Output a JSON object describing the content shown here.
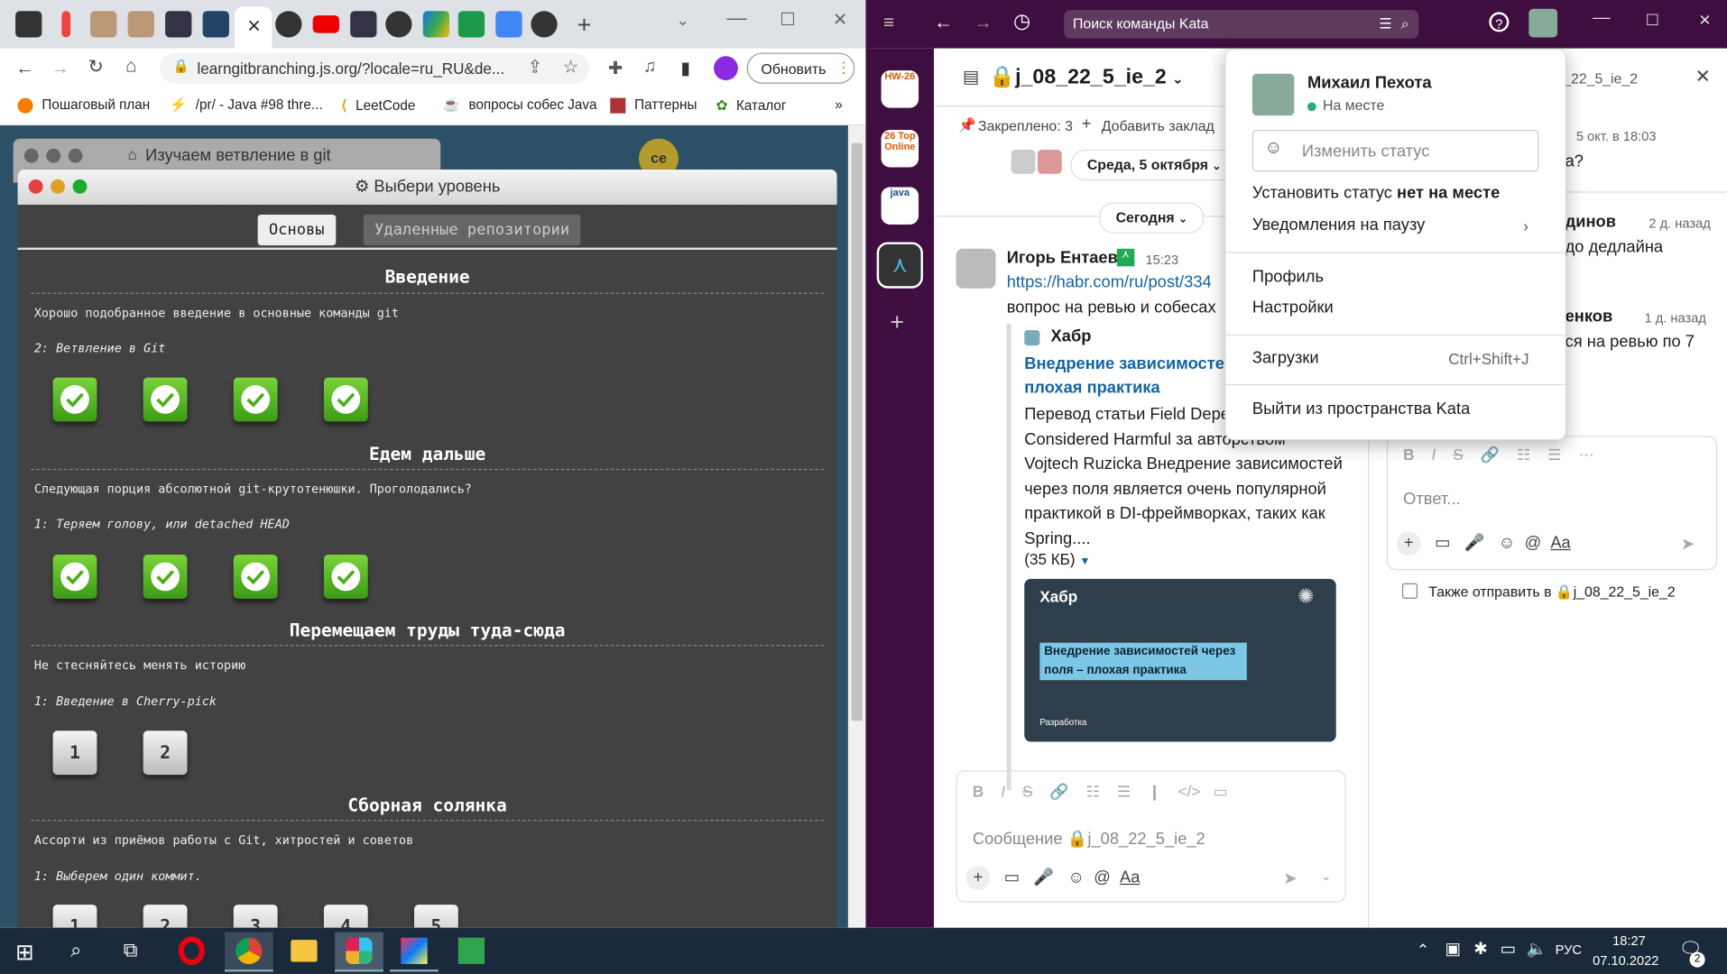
{
  "browser": {
    "url": "learngitbranching.js.org/?locale=ru_RU&de...",
    "update_button": "Обновить",
    "bookmarks": [
      "Пошаговый план",
      "/pr/ - Java #98 thre...",
      "LeetCode",
      "вопросы собес Java",
      "Паттерны",
      "Каталог"
    ]
  },
  "gitapp": {
    "bg_window_title": "Изучаем ветвление в git",
    "avatar_initials": "ce",
    "window_title": "Выбери уровень",
    "tabs": [
      "Основы",
      "Удаленные репозитории"
    ],
    "sections": [
      {
        "title": "Введение",
        "desc": "Хорошо подобранное введение в основные команды git",
        "sub": "2: Ветвление в Git",
        "levels": [
          "done",
          "done",
          "done",
          "done"
        ]
      },
      {
        "title": "Едем дальше",
        "desc": "Следующая порция абсолютной git-крутотенюшки. Проголодались?",
        "sub": "1: Теряем голову, или detached HEAD",
        "levels": [
          "done",
          "done",
          "done",
          "done"
        ]
      },
      {
        "title": "Перемещаем труды туда-сюда",
        "desc": "Не стесняйтесь менять историю",
        "sub": "1: Введение в Cherry-pick",
        "levels": [
          "1",
          "2"
        ]
      },
      {
        "title": "Сборная солянка",
        "desc": "Ассорти из приёмов работы с Git, хитростей и советов",
        "sub": "1: Выберем один коммит.",
        "levels": [
          "1",
          "2",
          "3",
          "4",
          "5"
        ]
      }
    ]
  },
  "slack": {
    "search_placeholder": "Поиск команды Kata",
    "workspaces": [
      "HW-26",
      "26 Top Online",
      "java"
    ],
    "channel_name": "j_08_22_5_ie_2",
    "pinned": "Закреплено: 3",
    "add_bookmark": "Добавить заклад",
    "date_chip": "Среда, 5 октября",
    "today_chip": "Сегодня",
    "message": {
      "author": "Игорь Ентаев",
      "time": "15:23",
      "link": "https://habr.com/ru/post/334",
      "text": "вопрос на ревью и собесах",
      "preview_site": "Хабр",
      "preview_title": "Внедрение зависимостей плохая практика",
      "preview_body": "Перевод статьи Field Depe Injection Considered Harmful за авторством Vojtech Ruzicka Внедрение зависимостей через поля является очень популярной практикой в DI-фреймворках, таких как Spring....",
      "preview_size": "(35 КБ)",
      "card_site": "Хабр",
      "card_title": "Внедрение зависимостей через поля – плохая практика",
      "card_tag": "Разработка"
    },
    "composer_placeholder": "Сообщение 🔒j_08_22_5_ie_2",
    "thread": {
      "header": "_22_5_ie_2",
      "m1_time": "5 окт. в 18:03",
      "m1_text": "а?",
      "m2_author": "динов",
      "m2_time": "2 д. назад",
      "m2_text": "до дедлайна",
      "m3_author": "енков",
      "m3_time": "1 д. назад",
      "m3_text": "ся на ревью по 7",
      "reply_placeholder": "Ответ...",
      "also_send": "Также отправить в",
      "also_channel": "j_08_22_5_ie_2"
    },
    "menu": {
      "user_name": "Михаил Пехота",
      "presence": "На месте",
      "status_placeholder": "Изменить статус",
      "set_away_prefix": "Установить статус",
      "set_away_bold": "нет на месте",
      "pause_notifications": "Уведомления на паузу",
      "profile": "Профиль",
      "settings": "Настройки",
      "downloads": "Загрузки",
      "downloads_shortcut": "Ctrl+Shift+J",
      "sign_out": "Выйти из пространства Kata"
    }
  },
  "taskbar": {
    "lang": "РУС",
    "time": "18:27",
    "date": "07.10.2022",
    "notif_count": "2"
  }
}
